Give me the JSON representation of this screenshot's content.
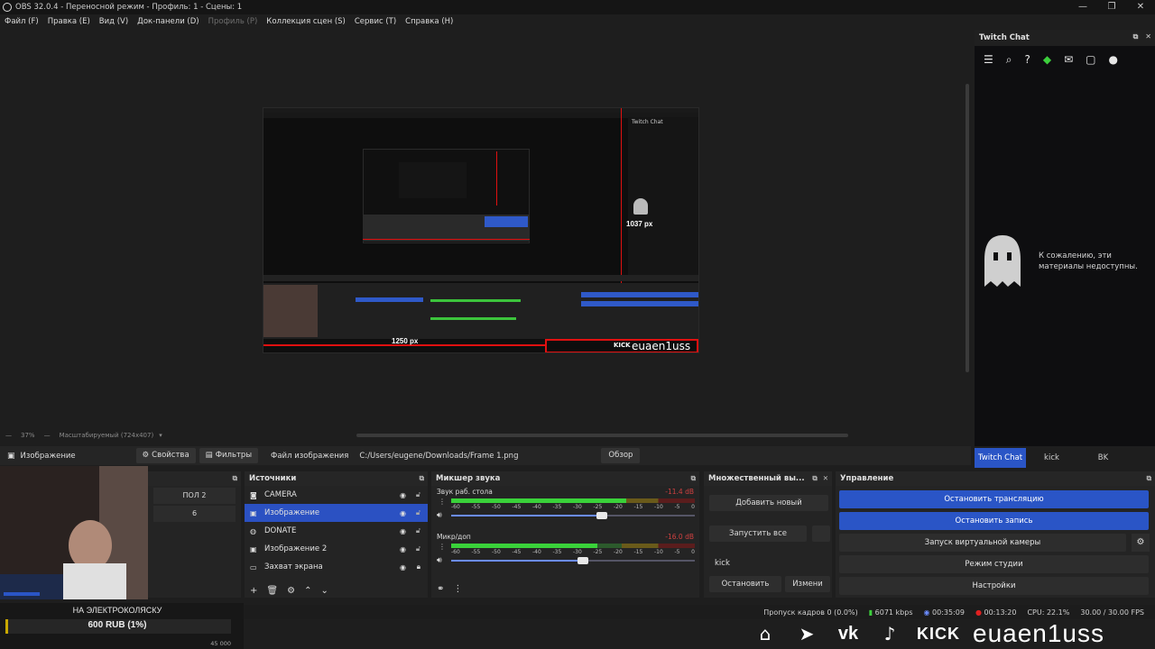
{
  "window": {
    "title": "OBS 32.0.4 - Переносной режим - Профиль: 1 - Сцены: 1",
    "controls": [
      "—",
      "❐",
      "✕"
    ]
  },
  "menu": [
    {
      "label": "Файл (F)",
      "disabled": false
    },
    {
      "label": "Правка (E)",
      "disabled": false
    },
    {
      "label": "Вид (V)",
      "disabled": false
    },
    {
      "label": "Док-панели (D)",
      "disabled": false
    },
    {
      "label": "Профиль (P)",
      "disabled": true
    },
    {
      "label": "Коллекция сцен (S)",
      "disabled": false
    },
    {
      "label": "Сервис (T)",
      "disabled": false
    },
    {
      "label": "Справка (H)",
      "disabled": false
    }
  ],
  "preview": {
    "width_label": "1250 px",
    "height_label": "1037 px",
    "zoom": "37%",
    "scale_mode": "Масштабируемый (724x407)",
    "dash": "—",
    "nested_nick": "euaen1uss",
    "nested_kick": "KICK"
  },
  "context": {
    "source_name": "Изображение",
    "properties": "Свойства",
    "filters": "Фильтры",
    "file_label": "Файл изображения",
    "file_path": "C:/Users/eugene/Downloads/Frame 1.png",
    "browse": "Обзор"
  },
  "chat": {
    "title": "Twitch Chat",
    "unavailable": "К сожалению, эти материалы недоступны.",
    "tabs": [
      {
        "label": "Twitch Chat",
        "active": true
      },
      {
        "label": "kick",
        "active": false
      },
      {
        "label": "BK",
        "active": false
      }
    ]
  },
  "scenes": {
    "rows": [
      "ПОЛ 2",
      "6"
    ]
  },
  "sources": {
    "title": "Источники",
    "items": [
      {
        "name": "CAMERA",
        "icon": "camera-icon",
        "selected": false,
        "locked": false
      },
      {
        "name": "Изображение",
        "icon": "image-icon",
        "selected": true,
        "locked": false
      },
      {
        "name": "DONATE",
        "icon": "globe-icon",
        "selected": false,
        "locked": false
      },
      {
        "name": "Изображение 2",
        "icon": "image-icon",
        "selected": false,
        "locked": false
      },
      {
        "name": "Захват экрана",
        "icon": "monitor-icon",
        "selected": false,
        "locked": true
      }
    ]
  },
  "mixer": {
    "title": "Микшер звука",
    "ticks": [
      "-60",
      "-55",
      "-50",
      "-45",
      "-40",
      "-35",
      "-30",
      "-25",
      "-20",
      "-15",
      "-10",
      "-5",
      "0"
    ],
    "channels": [
      {
        "name": "Звук раб. стола",
        "db": "-11.4 dB",
        "level": 0.72,
        "volume": 0.62
      },
      {
        "name": "Микр/доп",
        "db": "-16.0 dB",
        "level": 0.6,
        "volume": 0.54
      }
    ]
  },
  "multi": {
    "title": "Множественный вы...",
    "add": "Добавить новый",
    "start_all": "Запустить все",
    "kick_label": "kick",
    "stop": "Остановить",
    "edit": "Измени"
  },
  "controls": {
    "title": "Управление",
    "buttons": [
      {
        "label": "Остановить трансляцию",
        "active": true
      },
      {
        "label": "Остановить запись",
        "active": true
      },
      {
        "label": "Запуск виртуальной камеры",
        "active": false
      },
      {
        "label": "Режим студии",
        "active": false
      },
      {
        "label": "Настройки",
        "active": false
      }
    ]
  },
  "status": {
    "dropped": "Пропуск кадров 0 (0.0%)",
    "bitrate": "6071 kbps",
    "stream_time": "00:35:09",
    "rec_time": "00:13:20",
    "cpu": "CPU: 22.1%",
    "fps": "30.00 / 30.00 FPS"
  },
  "donation": {
    "title": "НА ЭЛЕКТРОКОЛЯСКУ",
    "amount": "600 RUB (1%)",
    "progress": 0.01,
    "goal": "45 000"
  },
  "social": {
    "kick": "KICK",
    "nick": "euaen1uss"
  },
  "colors": {
    "accent": "#2a55c6",
    "guide": "#e01010",
    "meter_green": "#3ad23a"
  }
}
